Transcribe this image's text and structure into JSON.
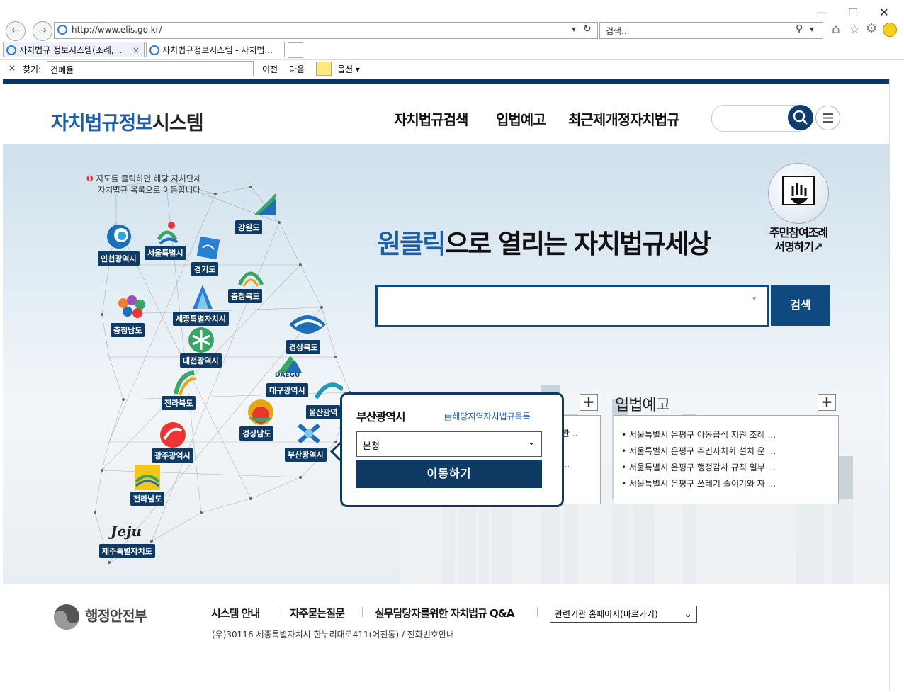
{
  "browser": {
    "url": "http://www.elis.go.kr/",
    "search_placeholder": "검색...",
    "tabs": [
      {
        "label": "자치법규 정보시스템(조례,..."
      },
      {
        "label": "자치법규정보시스템 - 자치법..."
      }
    ],
    "find": {
      "label": "찾기:",
      "query": "건폐율",
      "prev": "이전",
      "next": "다음",
      "options": "옵션"
    },
    "window_min": "—",
    "window_max": "☐",
    "window_close": "✕"
  },
  "header": {
    "logo_part1": "자치법규정보",
    "logo_part2": "시스템",
    "nav": [
      "자치법규검색",
      "입법예고",
      "최근제개정자치법규"
    ]
  },
  "hero": {
    "map_note_line1": "지도를 클릭하면 해당 자치단체",
    "map_note_line2": "자치법규 목록으로 이동합니다",
    "regions": [
      "강원도",
      "인천광역시",
      "서울특별시",
      "경기도",
      "충청북도",
      "충청남도",
      "세종특별자치시",
      "경상북도",
      "대전광역시",
      "대구광역시",
      "전라북도",
      "울산광역",
      "경상남도",
      "부산광역시",
      "광주광역시",
      "전라남도",
      "제주특별자치도"
    ],
    "daegu_emblem_text": "DAEGU",
    "jeju_emblem_text": "Jeju",
    "headline_highlight": "원클릭",
    "headline_rest": "으로 열리는 자치법규세상",
    "search_button": "검색",
    "sign_line1": "주민참여조례",
    "sign_line2": "서명하기"
  },
  "legislation_panel": {
    "title": "입법예고",
    "items": [
      "서울특별시 은평구 아동급식 지원 조례 ...",
      "서울특별시 은평구 주민자치회 설치 운 ...",
      "서울특별시 은평구 행정감사 규칙 일부 ...",
      "서울특별시 은평구 쓰레기 줄이기와 자 ..."
    ],
    "left_items": [
      "관 ..",
      "..."
    ]
  },
  "popup": {
    "title": "부산광역시",
    "link": "해당지역자치법규목록",
    "select_value": "본청",
    "button": "이동하기"
  },
  "footer": {
    "ministry": "행정안전부",
    "links": [
      "시스템 안내",
      "자주묻는질문",
      "실무담당자를위한 자치법규 Q&A"
    ],
    "related_select": "관련기관 홈페이지(바로가기)",
    "address": "(우)30116 세종특별자치시 한누리대로411(어진동) / 전화번호안내"
  },
  "colors": {
    "brand_navy": "#0f3a63",
    "brand_blue": "#1e5ea4"
  }
}
